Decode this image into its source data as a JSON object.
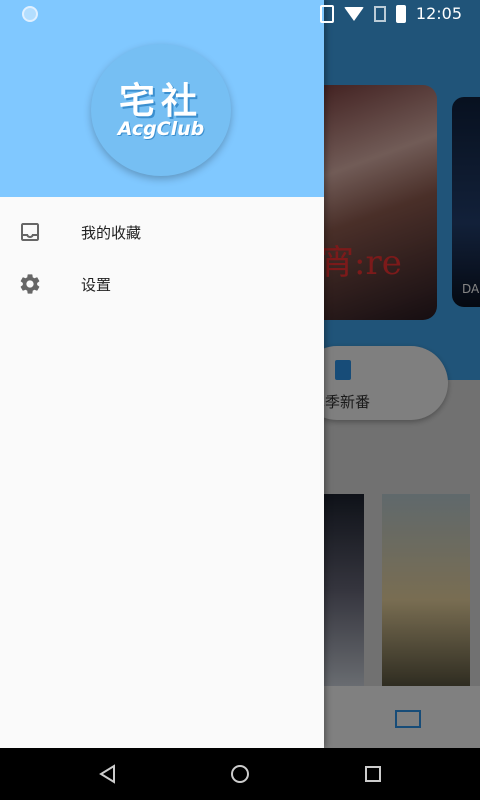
{
  "status_bar": {
    "time": "12:05"
  },
  "drawer": {
    "logo": {
      "title": "宅社",
      "subtitle": "AcgClub"
    },
    "menu": [
      {
        "label": "我的收藏",
        "icon": "inbox-icon"
      },
      {
        "label": "设置",
        "icon": "gear-icon"
      }
    ]
  },
  "background_app": {
    "card_text_1": "宵:re",
    "card_text_2": "DA",
    "season_button": "本季新番"
  },
  "colors": {
    "header": "#80c8ff",
    "logo_circle": "#76bff3",
    "app_blue": "#3fa2e8"
  }
}
